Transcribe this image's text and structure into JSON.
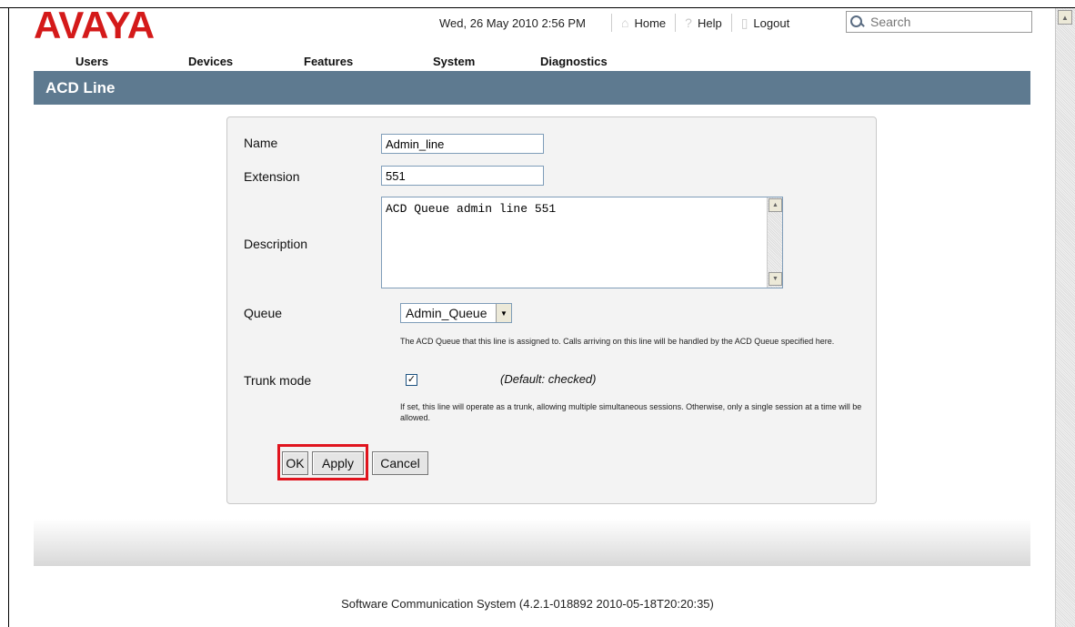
{
  "brand": {
    "logo_text": "AVAYA"
  },
  "topbar": {
    "datetime": "Wed, 26 May 2010 2:56 PM",
    "home_label": "Home",
    "help_label": "Help",
    "logout_label": "Logout",
    "search_placeholder": "Search"
  },
  "menu": {
    "items": [
      "Users",
      "Devices",
      "Features",
      "System",
      "Diagnostics"
    ]
  },
  "page": {
    "title": "ACD Line"
  },
  "form": {
    "name_label": "Name",
    "name_value": "Admin_line",
    "extension_label": "Extension",
    "extension_value": "551",
    "description_label": "Description",
    "description_value": "ACD Queue admin line 551",
    "queue_label": "Queue",
    "queue_value": "Admin_Queue",
    "queue_hint": "The ACD Queue that this line is assigned to. Calls arriving on this line will be handled by the ACD Queue specified here.",
    "trunk_label": "Trunk mode",
    "trunk_checked": true,
    "trunk_default": "(Default: checked)",
    "trunk_hint": "If set, this line will operate as a trunk, allowing multiple simultaneous sessions. Otherwise, only a single session at a time will be allowed."
  },
  "buttons": {
    "ok": "OK",
    "apply": "Apply",
    "cancel": "Cancel"
  },
  "footer": {
    "text": "Software Communication System (4.2.1-018892 2010-05-18T20:20:35)"
  },
  "colors": {
    "brand_red": "#d41a1a",
    "titlebar": "#5e7a90",
    "highlight": "#e0141e"
  }
}
